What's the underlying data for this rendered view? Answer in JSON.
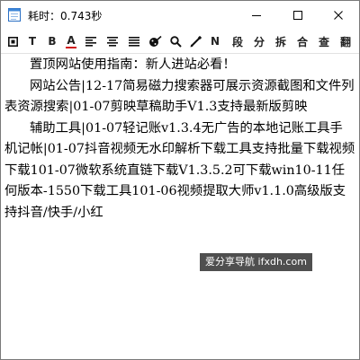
{
  "window": {
    "title": "耗时：0.743秒",
    "icon": "notepad-icon"
  },
  "toolbar": {
    "items": [
      {
        "name": "text-box-icon"
      },
      {
        "name": "T",
        "label": "T"
      },
      {
        "name": "B",
        "label": "B"
      },
      {
        "name": "A",
        "label": "A",
        "accent": "#d01818"
      },
      {
        "name": "align-left-icon"
      },
      {
        "name": "align-center-icon"
      },
      {
        "name": "align-justify-icon"
      },
      {
        "name": "palette-icon"
      },
      {
        "name": "search-icon"
      },
      {
        "name": "pen-icon"
      },
      {
        "name": "N",
        "label": "N"
      },
      {
        "name": "段",
        "label": "段"
      },
      {
        "name": "分",
        "label": "分"
      },
      {
        "name": "拆",
        "label": "拆"
      },
      {
        "name": "合",
        "label": "合"
      },
      {
        "name": "查",
        "label": "查"
      },
      {
        "name": "翻",
        "label": "翻"
      }
    ]
  },
  "content": {
    "paragraphs": [
      "置顶网站使用指南：新人进站必看！",
      "网站公告|12-17简易磁力搜索器可展示资源截图和文件列表资源搜索|01-07剪映草稿助手V1.3支持最新版剪映",
      "辅助工具|01-07轻记账v1.3.4无广告的本地记账工具手机记帐|01-07抖音视频无水印解析下载工具支持批量下载视频下载101-07微软系统直链下载V1.3.5.2可下载win10-11任何版本-1550下载工具101-06视频提取大师v1.1.0高级版支持抖音/快手/小红"
    ]
  },
  "watermark": "爱分享导航 ifxdh.com"
}
